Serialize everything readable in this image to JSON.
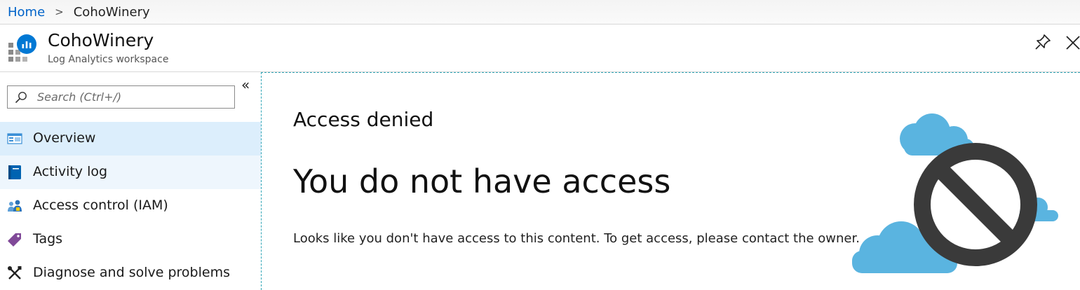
{
  "breadcrumb": {
    "home": "Home",
    "separator": ">",
    "current": "CohoWinery"
  },
  "header": {
    "title": "CohoWinery",
    "subtitle": "Log Analytics workspace",
    "icon": "log-analytics-workspace-icon",
    "pin_icon": "pin-icon",
    "close_icon": "close-icon"
  },
  "sidebar": {
    "collapse_label": "«",
    "search": {
      "placeholder": "Search (Ctrl+/)",
      "value": ""
    },
    "items": [
      {
        "label": "Overview",
        "icon": "overview-icon",
        "state": "selected"
      },
      {
        "label": "Activity log",
        "icon": "activity-log-icon",
        "state": "hover"
      },
      {
        "label": "Access control (IAM)",
        "icon": "access-control-icon",
        "state": "normal"
      },
      {
        "label": "Tags",
        "icon": "tag-icon",
        "state": "normal"
      },
      {
        "label": "Diagnose and solve problems",
        "icon": "wrench-icon",
        "state": "normal"
      }
    ]
  },
  "content": {
    "eyebrow": "Access denied",
    "headline": "You do not have access",
    "message": "Looks like you don't have access to this content. To get access, please contact the owner.",
    "illustration": "no-access-clouds-illustration"
  },
  "colors": {
    "link": "#0063c9",
    "selected_bg": "#dceefc",
    "hover_bg": "#eef6fd",
    "accent_blue": "#0078d4",
    "cloud_blue": "#5ab4e0"
  }
}
